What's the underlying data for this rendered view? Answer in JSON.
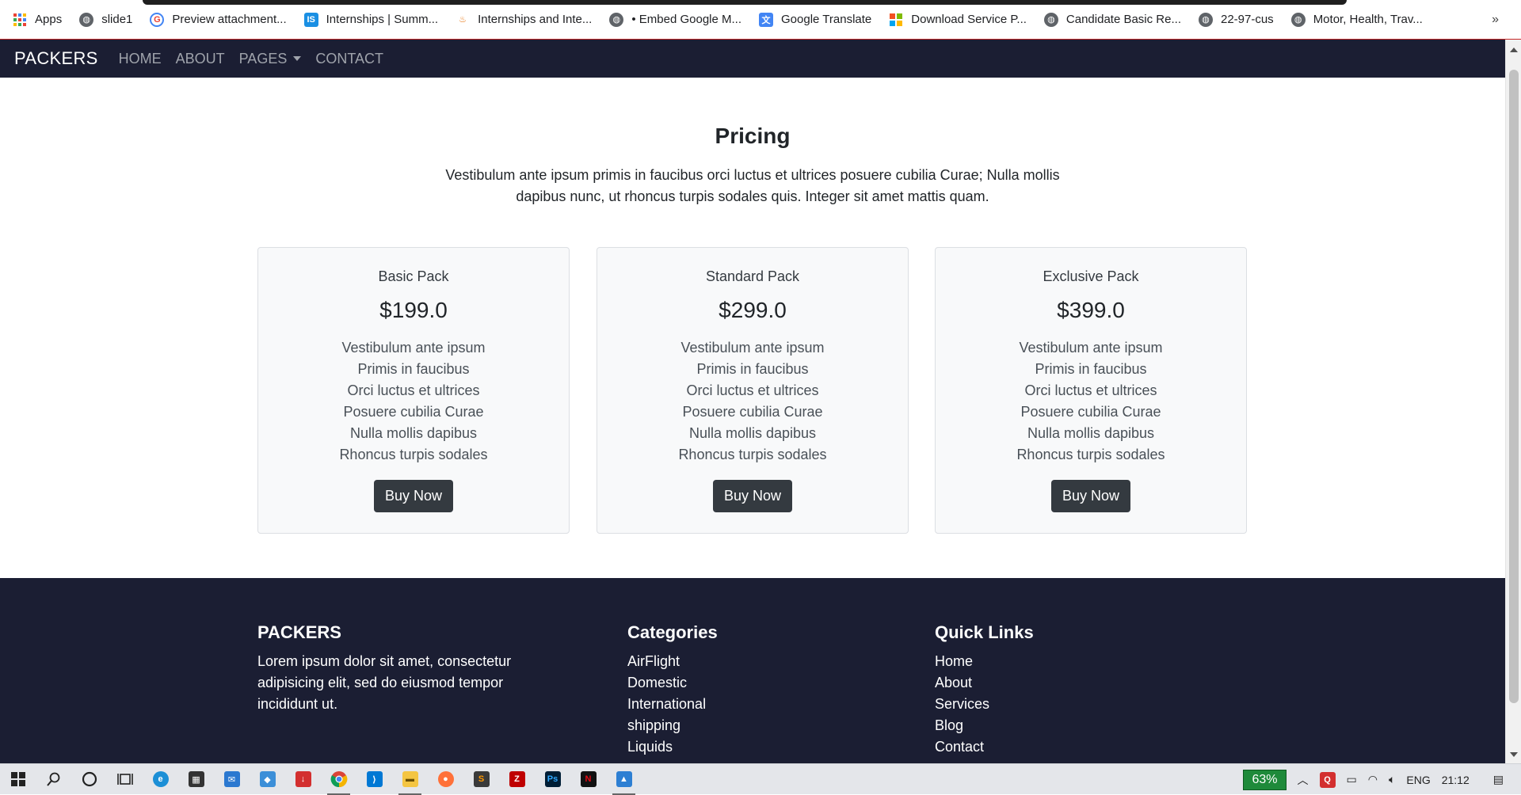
{
  "bookmarks": [
    {
      "label": "Apps",
      "icon": "apps-grid-icon"
    },
    {
      "label": "slide1",
      "icon": "globe-icon"
    },
    {
      "label": "Preview attachment...",
      "icon": "google-icon"
    },
    {
      "label": "Internships | Summ...",
      "icon": "internshala-icon"
    },
    {
      "label": "Internships and Inte...",
      "icon": "fire-icon"
    },
    {
      "label": "• Embed Google M...",
      "icon": "globe-icon"
    },
    {
      "label": "Google Translate",
      "icon": "translate-icon"
    },
    {
      "label": "Download Service P...",
      "icon": "microsoft-icon"
    },
    {
      "label": "Candidate Basic Re...",
      "icon": "globe-icon"
    },
    {
      "label": "22-97-cus",
      "icon": "globe-icon"
    },
    {
      "label": "Motor, Health, Trav...",
      "icon": "globe-icon"
    }
  ],
  "bookmarks_more": "»",
  "nav": {
    "brand": "PACKERS",
    "links": [
      "HOME",
      "ABOUT",
      "PAGES",
      "CONTACT"
    ]
  },
  "pricing": {
    "title": "Pricing",
    "description": "Vestibulum ante ipsum primis in faucibus orci luctus et ultrices posuere cubilia Curae; Nulla mollis dapibus nunc, ut rhoncus turpis sodales quis. Integer sit amet mattis quam.",
    "cards": [
      {
        "name": "Basic Pack",
        "price": "$199.0",
        "features": [
          "Vestibulum ante ipsum",
          "Primis in faucibus",
          "Orci luctus et ultrices",
          "Posuere cubilia Curae",
          "Nulla mollis dapibus",
          "Rhoncus turpis sodales"
        ],
        "button": "Buy Now"
      },
      {
        "name": "Standard Pack",
        "price": "$299.0",
        "features": [
          "Vestibulum ante ipsum",
          "Primis in faucibus",
          "Orci luctus et ultrices",
          "Posuere cubilia Curae",
          "Nulla mollis dapibus",
          "Rhoncus turpis sodales"
        ],
        "button": "Buy Now"
      },
      {
        "name": "Exclusive Pack",
        "price": "$399.0",
        "features": [
          "Vestibulum ante ipsum",
          "Primis in faucibus",
          "Orci luctus et ultrices",
          "Posuere cubilia Curae",
          "Nulla mollis dapibus",
          "Rhoncus turpis sodales"
        ],
        "button": "Buy Now"
      }
    ]
  },
  "footer": {
    "about": {
      "title": "PACKERS",
      "text": "Lorem ipsum dolor sit amet, consectetur adipisicing elit, sed do eiusmod tempor incididunt ut."
    },
    "categories": {
      "title": "Categories",
      "links": [
        "AirFlight",
        "Domestic",
        "International",
        "shipping",
        "Liquids"
      ]
    },
    "quick_links": {
      "title": "Quick Links",
      "links": [
        "Home",
        "About",
        "Services",
        "Blog",
        "Contact"
      ]
    }
  },
  "taskbar": {
    "battery": "63%",
    "language": "ENG",
    "time": "21:12"
  },
  "colors": {
    "navbar_bg": "#1b1e33",
    "button_bg": "#343a40",
    "card_bg": "#f8f9fa"
  }
}
